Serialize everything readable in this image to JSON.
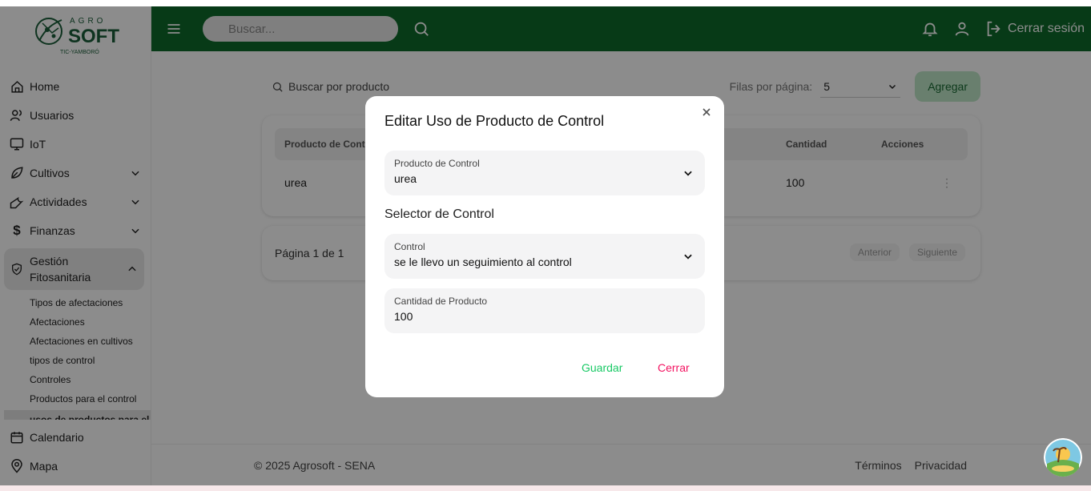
{
  "logo": {
    "line1": "AGRO",
    "line2": "SOFT",
    "line3": "TIC-YAMBORÓ"
  },
  "sidebar": {
    "items": [
      {
        "label": "Home"
      },
      {
        "label": "Usuarios"
      },
      {
        "label": "IoT"
      },
      {
        "label": "Cultivos"
      },
      {
        "label": "Actividades"
      },
      {
        "label": "Finanzas"
      },
      {
        "label": "Gestión Fitosanitaria"
      },
      {
        "label": "Calendario"
      },
      {
        "label": "Mapa"
      }
    ],
    "sub": [
      "Tipos de afectaciones",
      "Afectaciones",
      "Afectaciones en cultivos",
      "tipos de control",
      "Controles",
      "Productos para el control",
      "usos de productos para el"
    ]
  },
  "topbar": {
    "search_placeholder": "Buscar...",
    "logout": "Cerrar sesión"
  },
  "main": {
    "search_placeholder": "Buscar por producto",
    "rows_label": "Filas por página:",
    "rows_value": "5",
    "add_button": "Agregar",
    "table": {
      "headers": [
        "Producto de Control",
        "Cantidad",
        "Acciones"
      ],
      "rows": [
        {
          "producto": "urea",
          "cantidad": "100"
        }
      ]
    },
    "pager": {
      "text": "Página 1 de 1",
      "prev": "Anterior",
      "next": "Siguiente"
    }
  },
  "footer": {
    "copy": "© 2025 Agrosoft - SENA",
    "terms": "Términos",
    "privacy": "Privacidad"
  },
  "modal": {
    "title": "Editar Uso de Producto de Control",
    "producto_label": "Producto de Control",
    "producto_value": "urea",
    "section": "Selector de Control",
    "control_label": "Control",
    "control_value": "se le llevo un seguimiento al control",
    "cantidad_label": "Cantidad de Producto",
    "cantidad_value": "100",
    "save": "Guardar",
    "close": "Cerrar"
  },
  "colors": {
    "primary": "#0e6b2b",
    "save": "#17c964",
    "close": "#f31260"
  }
}
